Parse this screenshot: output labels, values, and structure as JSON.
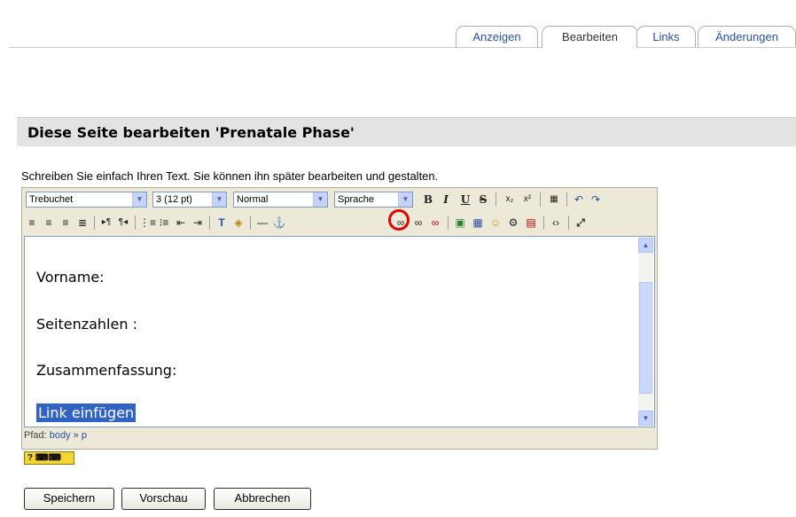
{
  "tabs": [
    {
      "label": "Anzeigen",
      "active": false
    },
    {
      "label": "Bearbeiten",
      "active": true
    },
    {
      "label": "Links",
      "active": false
    },
    {
      "label": "Änderungen",
      "active": false
    }
  ],
  "page_heading": "Diese Seite bearbeiten 'Prenatale Phase'",
  "instructions": "Schreiben Sie einfach Ihren Text. Sie können ihn später bearbeiten und gestalten.",
  "toolbar": {
    "font_family": "Trebuchet",
    "font_size": "3 (12 pt)",
    "paragraph_format": "Normal",
    "language": "Sprache",
    "bold": "B",
    "italic": "I",
    "underline": "U",
    "strike": "S"
  },
  "content": {
    "lines": [
      "Vorname:",
      "Seitenzahlen :",
      "Zusammenfassung:"
    ],
    "selected_text": "Link einfügen"
  },
  "statusbar": {
    "label": "Pfad:",
    "crumb1": "body",
    "separator": "»",
    "crumb2": "p"
  },
  "help_button": "?",
  "buttons": {
    "save": "Speichern",
    "preview": "Vorschau",
    "cancel": "Abbrechen"
  }
}
